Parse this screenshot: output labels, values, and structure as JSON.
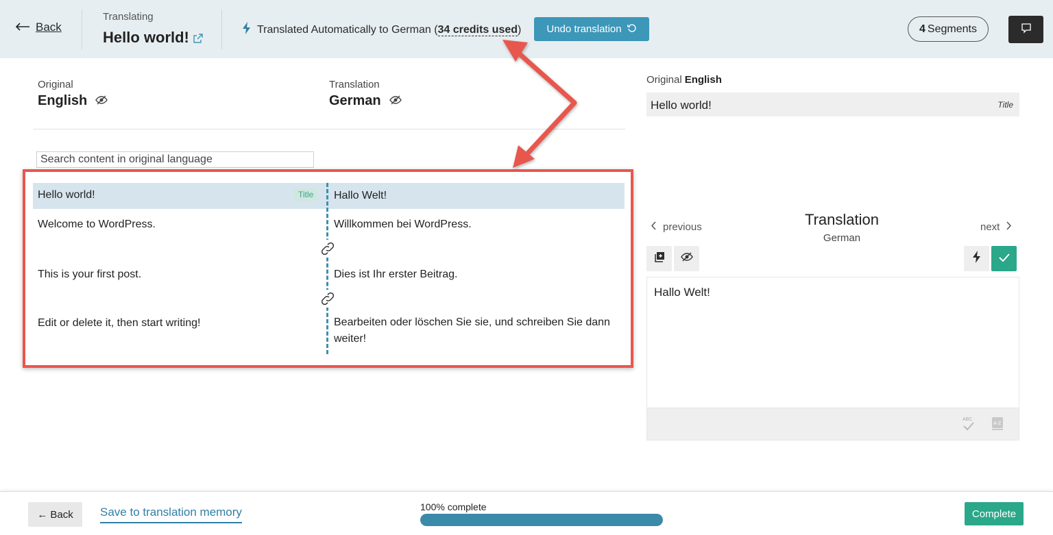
{
  "header": {
    "back_label": "Back",
    "translating_label": "Translating",
    "doc_title": "Hello world!",
    "auto_status_prefix": "Translated Automatically to German (",
    "credits_used": "34 credits used",
    "auto_status_suffix": ")",
    "undo_label": "Undo translation",
    "segments_count": "4",
    "segments_label": "Segments"
  },
  "languages": {
    "original_label": "Original",
    "original_lang": "English",
    "translation_label": "Translation",
    "translation_lang": "German"
  },
  "search": {
    "placeholder": "Search content in original language"
  },
  "segments": [
    {
      "source": "Hello world!",
      "target": "Hallo Welt!",
      "badge": "Title",
      "active": true
    },
    {
      "source": "Welcome to WordPress.",
      "target": "Willkommen bei WordPress."
    },
    {
      "source": "This is your first post.",
      "target": "Dies ist Ihr erster Beitrag."
    },
    {
      "source": "Edit or delete it, then start writing!",
      "target": "Bearbeiten oder löschen Sie sie, und schreiben Sie dann weiter!"
    }
  ],
  "right_panel": {
    "original_label": "Original",
    "original_lang": "English",
    "original_text": "Hello world!",
    "original_tag": "Title",
    "prev_label": "previous",
    "next_label": "next",
    "translation_title": "Translation",
    "translation_lang": "German",
    "editor_value": "Hallo Welt!"
  },
  "footer": {
    "back_label": "← Back",
    "save_tm_label": "Save to translation memory",
    "progress_label": "100% complete",
    "progress_fraction": 1.0,
    "complete_label": "Complete"
  },
  "colors": {
    "header_bg": "#e7eef1",
    "accent_blue": "#3c97b8",
    "accent_green": "#2aa889",
    "annotation_red": "#e8574e",
    "active_row": "#d6e4ee"
  }
}
